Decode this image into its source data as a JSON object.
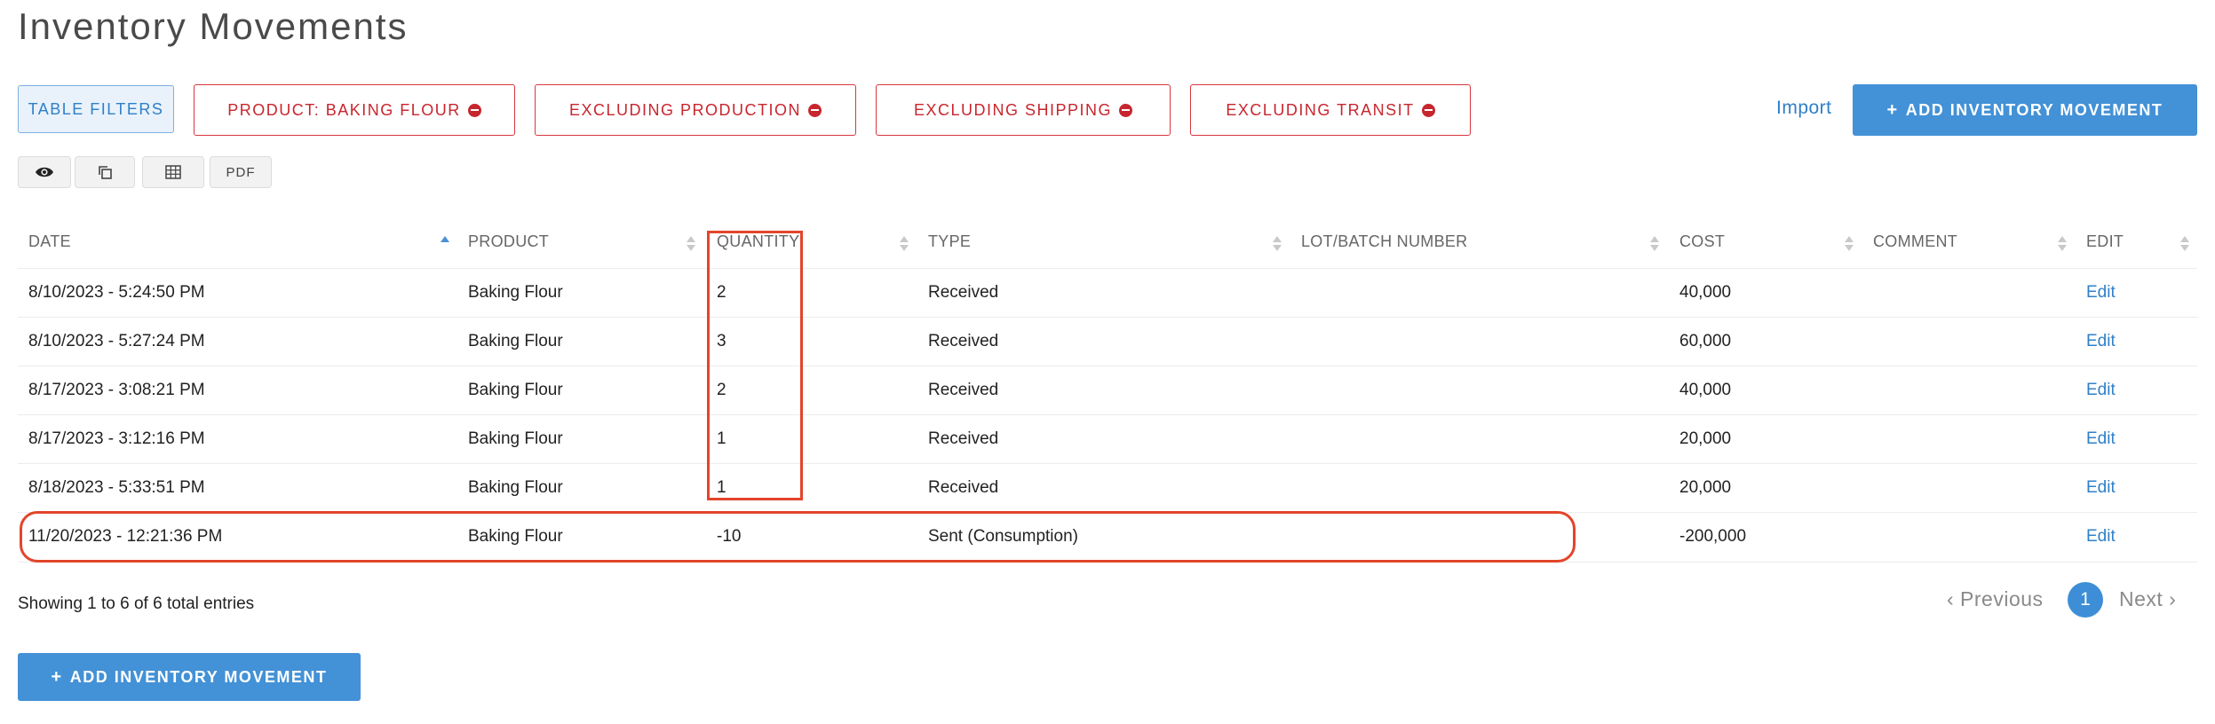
{
  "page": {
    "title": "Inventory Movements"
  },
  "toolbar": {
    "table_filters_label": "TABLE FILTERS",
    "filters": [
      {
        "label": "PRODUCT: BAKING FLOUR"
      },
      {
        "label": "EXCLUDING PRODUCTION"
      },
      {
        "label": "EXCLUDING SHIPPING"
      },
      {
        "label": "EXCLUDING TRANSIT"
      }
    ],
    "import_label": "Import",
    "add_label": "ADD INVENTORY MOVEMENT",
    "add_icon": "+",
    "export_buttons": [
      {
        "icon": "eye-icon"
      },
      {
        "icon": "copy-icon"
      },
      {
        "icon": "table-icon"
      },
      {
        "label": "PDF"
      }
    ]
  },
  "table": {
    "columns": [
      {
        "label": "DATE",
        "sort": "ascending"
      },
      {
        "label": "PRODUCT",
        "sort": "none"
      },
      {
        "label": "QUANTITY",
        "sort": "none"
      },
      {
        "label": "TYPE",
        "sort": "none"
      },
      {
        "label": "LOT/BATCH NUMBER",
        "sort": "none"
      },
      {
        "label": "COST",
        "sort": "none"
      },
      {
        "label": "COMMENT",
        "sort": "none"
      },
      {
        "label": "EDIT",
        "sort": "none"
      }
    ],
    "rows": [
      {
        "date": "8/10/2023 - 5:24:50 PM",
        "product": "Baking Flour",
        "quantity": "2",
        "type": "Received",
        "lot": "",
        "cost": "40,000",
        "comment": "",
        "edit": "Edit"
      },
      {
        "date": "8/10/2023 - 5:27:24 PM",
        "product": "Baking Flour",
        "quantity": "3",
        "type": "Received",
        "lot": "",
        "cost": "60,000",
        "comment": "",
        "edit": "Edit"
      },
      {
        "date": "8/17/2023 - 3:08:21 PM",
        "product": "Baking Flour",
        "quantity": "2",
        "type": "Received",
        "lot": "",
        "cost": "40,000",
        "comment": "",
        "edit": "Edit"
      },
      {
        "date": "8/17/2023 - 3:12:16 PM",
        "product": "Baking Flour",
        "quantity": "1",
        "type": "Received",
        "lot": "",
        "cost": "20,000",
        "comment": "",
        "edit": "Edit"
      },
      {
        "date": "8/18/2023 - 5:33:51 PM",
        "product": "Baking Flour",
        "quantity": "1",
        "type": "Received",
        "lot": "",
        "cost": "20,000",
        "comment": "",
        "edit": "Edit"
      },
      {
        "date": "11/20/2023 - 12:21:36 PM",
        "product": "Baking Flour",
        "quantity": "-10",
        "type": "Sent (Consumption)",
        "lot": "",
        "cost": "-200,000",
        "comment": "",
        "edit": "Edit"
      }
    ]
  },
  "footer": {
    "entries_text": "Showing 1 to 6 of 6 total entries",
    "previous_label": "‹ Previous",
    "current_page": "1",
    "next_label": "Next ›",
    "add_label": "ADD INVENTORY MOVEMENT",
    "add_icon": "+"
  },
  "annotations": {
    "highlight_color": "#e2452b",
    "accent_color": "#4391d6",
    "filter_color": "#c8262e"
  }
}
